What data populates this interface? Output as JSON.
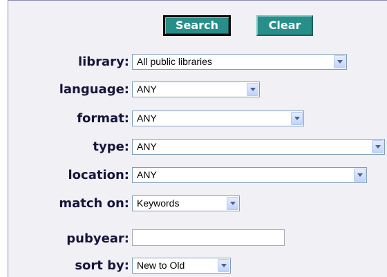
{
  "buttons": {
    "search_label": "Search",
    "clear_label": "Clear"
  },
  "fields": {
    "library": {
      "label": "library:",
      "value": "All public libraries"
    },
    "language": {
      "label": "language:",
      "value": "ANY"
    },
    "format": {
      "label": "format:",
      "value": "ANY"
    },
    "type": {
      "label": "type:",
      "value": "ANY"
    },
    "location": {
      "label": "location:",
      "value": "ANY"
    },
    "match_on": {
      "label": "match on:",
      "value": "Keywords"
    },
    "pubyear": {
      "label": "pubyear:",
      "value": ""
    },
    "sort_by": {
      "label": "sort by:",
      "value": "New to Old"
    }
  },
  "colors": {
    "button_bg": "#288e8a",
    "label_text": "#15153a",
    "panel_bg": "#f0f0f5"
  },
  "icons": {
    "dropdown": "chevron-down-icon"
  }
}
